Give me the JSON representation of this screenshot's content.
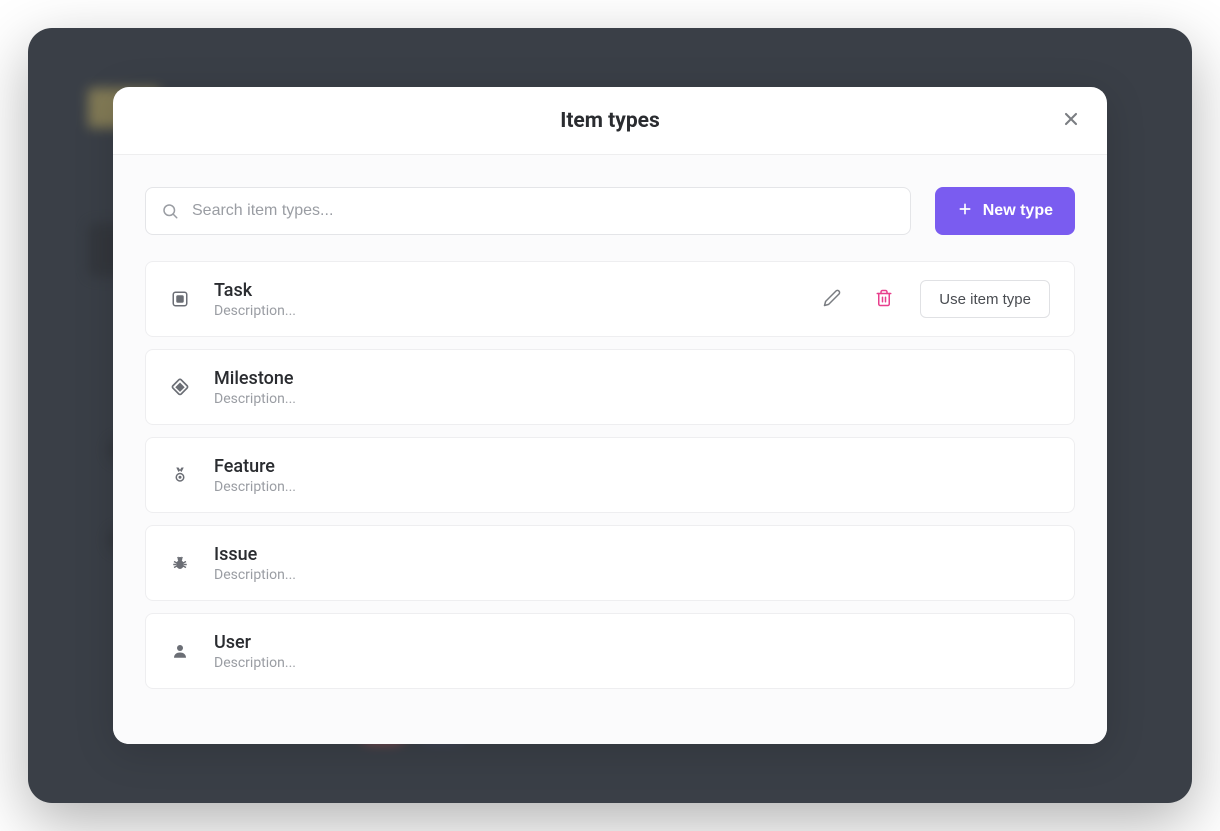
{
  "modal": {
    "title": "Item types",
    "search_placeholder": "Search item types...",
    "new_type_label": "New type",
    "use_label": "Use item type"
  },
  "items": [
    {
      "name": "Task",
      "description": "Description...",
      "icon": "square-icon",
      "active": true
    },
    {
      "name": "Milestone",
      "description": "Description...",
      "icon": "diamond-icon",
      "active": false
    },
    {
      "name": "Feature",
      "description": "Description...",
      "icon": "medal-icon",
      "active": false
    },
    {
      "name": "Issue",
      "description": "Description...",
      "icon": "bug-icon",
      "active": false
    },
    {
      "name": "User",
      "description": "Description...",
      "icon": "user-icon",
      "active": false
    }
  ],
  "colors": {
    "accent": "#7a5cf0",
    "danger": "#e83e8c"
  }
}
